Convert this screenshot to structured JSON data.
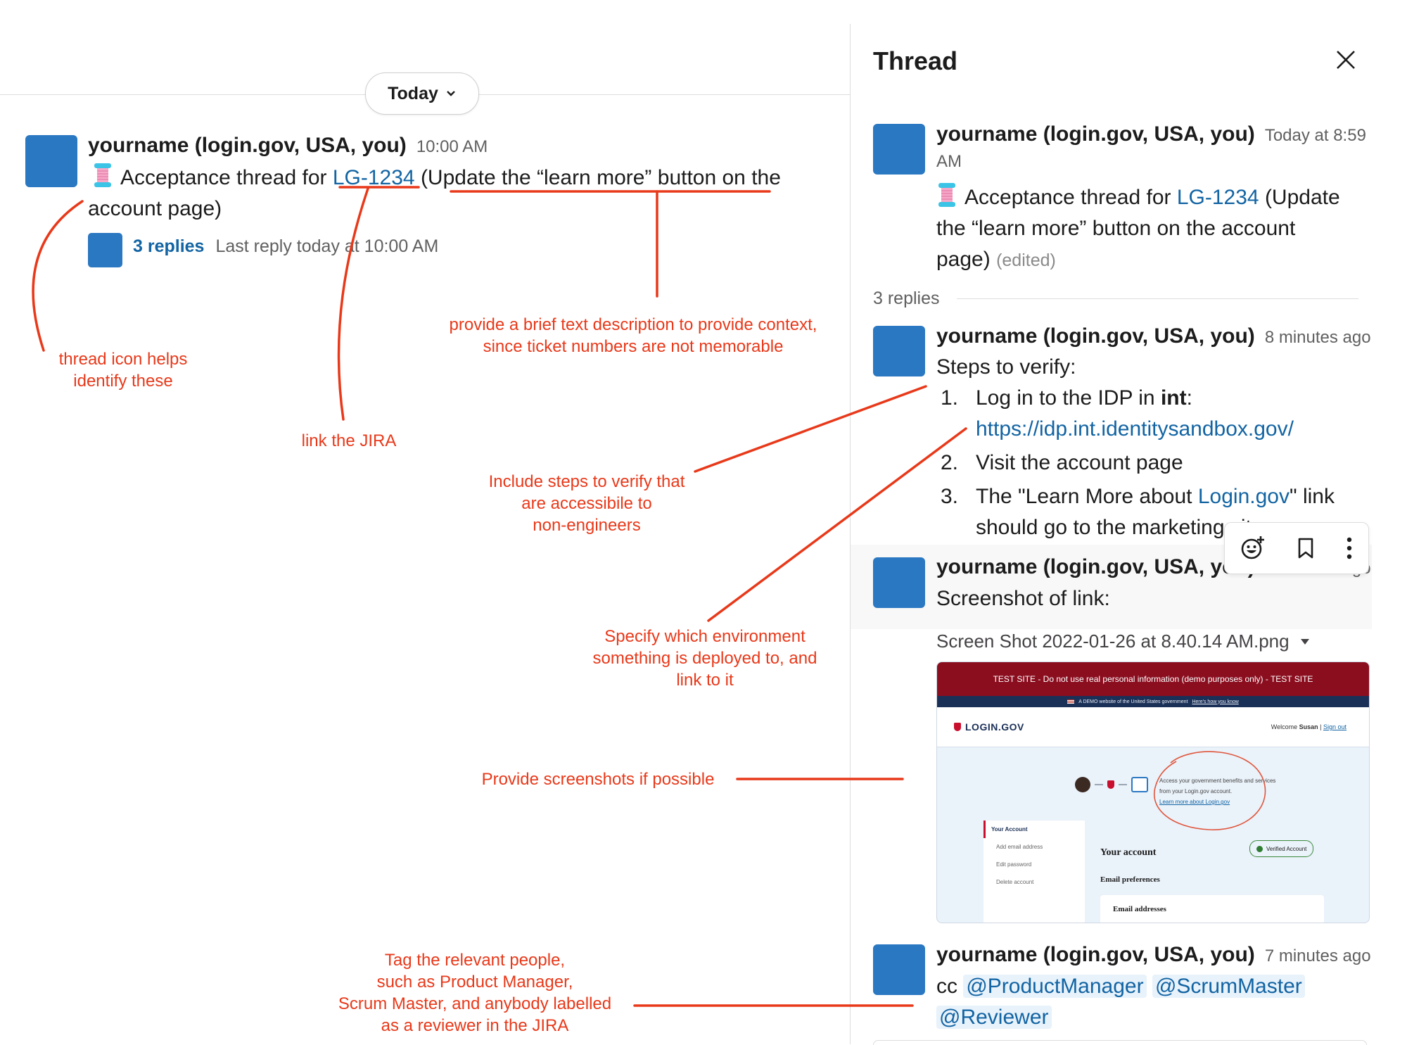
{
  "channel": {
    "date_pill": "Today",
    "message": {
      "author": "yourname (login.gov, USA, you)",
      "time": "10:00 AM",
      "text_before": "Acceptance thread for ",
      "ticket": "LG-1234",
      "text_after_line1": " (Update the “learn more” button on the",
      "text_line2": "account page)",
      "replies_label": "3 replies",
      "last_reply": "Last reply today at 10:00 AM"
    }
  },
  "thread": {
    "title": "Thread",
    "parent": {
      "author": "yourname (login.gov, USA, you)",
      "time_line1": "Today at 8:59",
      "time_line2": "AM",
      "text_before": "Acceptance thread for ",
      "ticket": "LG-1234",
      "text_after_line1": " (Update",
      "text_line2": "the “learn more” button on the account",
      "text_line3": "page)",
      "edited": "(edited)"
    },
    "replies_count": "3 replies",
    "reply1": {
      "author": "yourname (login.gov, USA, you)",
      "time": "8 minutes ago",
      "intro": "Steps to verify:",
      "step1_num": "1.",
      "step1_text": "Log in to the IDP in ",
      "step1_bold": "int",
      "step1_colon": ":",
      "step1_url": "https://idp.int.identitysandbox.gov/",
      "step2_num": "2.",
      "step2_text": "Visit the account page",
      "step3_num": "3.",
      "step3_text_a": "The \"Learn More about ",
      "step3_link": "Login.gov",
      "step3_text_b": "\" link",
      "step3_line2": "should go to the marketing site"
    },
    "reply2": {
      "author": "yourname (login.gov, USA, you)",
      "time": "7 minutes ago",
      "text": "Screenshot of link:",
      "file_name": "Screen Shot 2022-01-26 at 8.40.14 AM.png",
      "shot": {
        "banner": "TEST SITE - Do not use real personal information (demo purposes only) - TEST SITE",
        "gov_bar": "A DEMO website of the United States government",
        "gov_link": "Here's how you know",
        "logo": "LOGIN.GOV",
        "welcome": "Welcome",
        "user": "Susan",
        "sign_out": "Sign out",
        "benefits_1": "Access your government benefits and services",
        "benefits_2": "from your Login.gov account.",
        "learn_more": "Learn more about Login.gov",
        "nav_active": "Your Account",
        "nav_1": "Add email address",
        "nav_2": "Edit password",
        "nav_3": "Delete account",
        "heading": "Your account",
        "verified": "Verified Account",
        "email_prefs": "Email preferences",
        "email_addresses": "Email addresses"
      }
    },
    "reply3": {
      "author": "yourname (login.gov, USA, you)",
      "time": "7 minutes ago",
      "cc": "cc",
      "mention1": "@ProductManager",
      "mention2": "@ScrumMaster",
      "mention3": "@Reviewer"
    },
    "hover_actions": {
      "emoji_icon": "add-reaction-icon",
      "bookmark_icon": "bookmark-icon",
      "more_icon": "more-vertical-icon"
    }
  },
  "annotations": {
    "thread_icon": [
      "thread icon helps",
      "identify these"
    ],
    "link_jira": "link the JIRA",
    "description": [
      "provide a brief text description to provide context,",
      "since ticket numbers are not memorable"
    ],
    "steps": [
      "Include steps to verify that",
      "are accessibile to",
      "non-engineers"
    ],
    "environment": [
      "Specify which environment",
      "something is deployed to, and",
      "link to it"
    ],
    "screenshots": "Provide screenshots if possible",
    "tag_people": [
      "Tag the relevant people,",
      "such as Product Manager,",
      "Scrum Master, and anybody labelled",
      "as a reviewer in the JIRA"
    ]
  },
  "colors": {
    "avatar": "#2b78c2",
    "link": "#1264a3",
    "annotation": "#e8391a",
    "banner": "#8b0e1f"
  }
}
